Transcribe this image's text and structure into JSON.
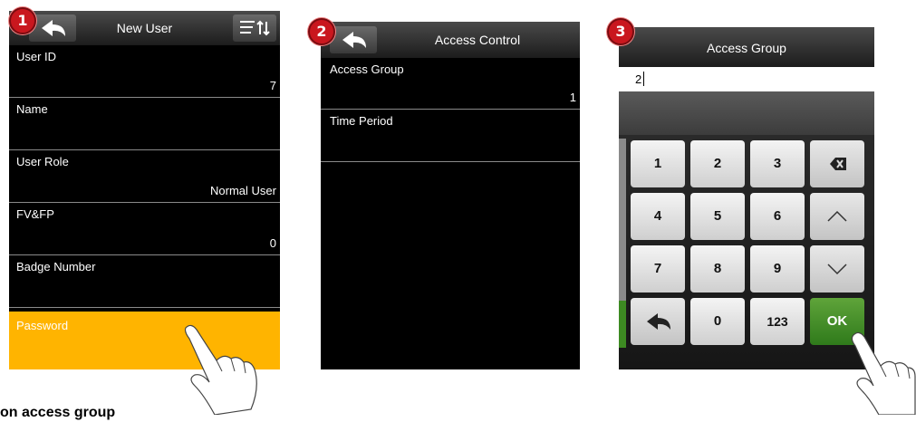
{
  "panel1": {
    "badge": "1",
    "title": "New User",
    "rows": [
      {
        "label": "User ID",
        "value": "7"
      },
      {
        "label": "Name",
        "value": ""
      },
      {
        "label": "User Role",
        "value": "Normal User"
      },
      {
        "label": "FV&FP",
        "value": "0"
      },
      {
        "label": "Badge Number",
        "value": ""
      },
      {
        "label": "Password",
        "value": ""
      }
    ]
  },
  "panel2": {
    "badge": "2",
    "title": "Access Control",
    "rows": [
      {
        "label": "Access Group",
        "value": "1"
      },
      {
        "label": "Time Period",
        "value": ""
      }
    ]
  },
  "panel3": {
    "badge": "3",
    "title": "Access Group",
    "input_value": "2",
    "keys": [
      "1",
      "2",
      "3",
      "4",
      "5",
      "6",
      "7",
      "8",
      "9",
      "0",
      "123",
      "OK"
    ]
  },
  "caption": "on access group",
  "colors": {
    "highlight": "#ffb400",
    "ok_green": "#3d8a22",
    "badge_red": "#c9171e"
  }
}
